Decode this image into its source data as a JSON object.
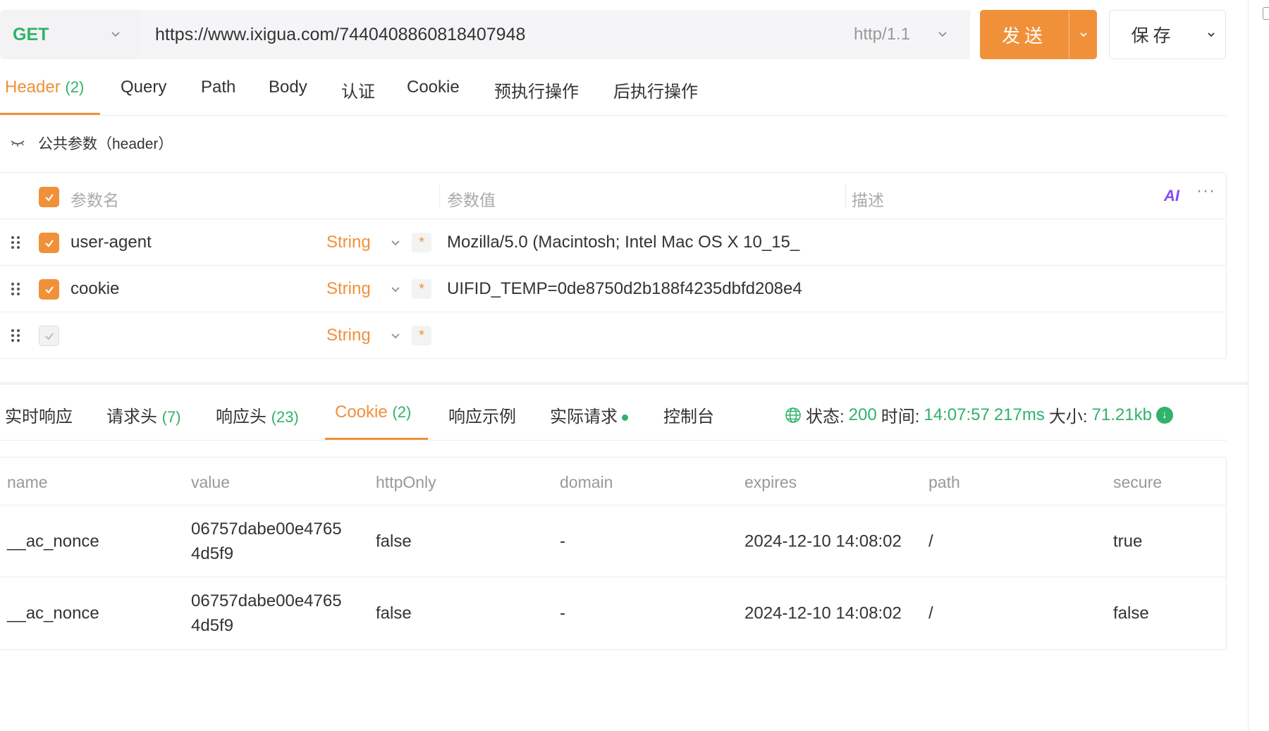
{
  "request": {
    "method": "GET",
    "url": "https://www.ixigua.com/7440408860818407948",
    "protocol": "http/1.1",
    "send_label": "发送",
    "save_label": "保存"
  },
  "request_tabs": [
    {
      "label": "Header",
      "count": "(2)",
      "active": true
    },
    {
      "label": "Query",
      "count": ""
    },
    {
      "label": "Path",
      "count": ""
    },
    {
      "label": "Body",
      "count": ""
    },
    {
      "label": "认证",
      "count": ""
    },
    {
      "label": "Cookie",
      "count": ""
    },
    {
      "label": "预执行操作",
      "count": ""
    },
    {
      "label": "后执行操作",
      "count": ""
    }
  ],
  "public_params": {
    "label": "公共参数（header）",
    "icon": "eye-closed-icon"
  },
  "header_table": {
    "columns": {
      "name": "参数名",
      "value": "参数值",
      "description": "描述"
    },
    "ai_label": "AI",
    "more_label": "···",
    "rows": [
      {
        "name": "user-agent",
        "type": "String",
        "required": "*",
        "value": "Mozilla/5.0 (Macintosh; Intel Mac OS X 10_15_",
        "checked": true
      },
      {
        "name": "cookie",
        "type": "String",
        "required": "*",
        "value": "UIFID_TEMP=0de8750d2b188f4235dbfd208e4",
        "checked": true
      },
      {
        "name": "",
        "type": "String",
        "required": "*",
        "value": "",
        "checked": false
      }
    ]
  },
  "response_tabs": [
    {
      "label": "实时响应",
      "count": ""
    },
    {
      "label": "请求头",
      "count": "(7)"
    },
    {
      "label": "响应头",
      "count": "(23)"
    },
    {
      "label": "Cookie",
      "count": "(2)",
      "active": true
    },
    {
      "label": "响应示例",
      "count": ""
    },
    {
      "label": "实际请求",
      "count": "",
      "dot": true
    },
    {
      "label": "控制台",
      "count": ""
    }
  ],
  "status": {
    "status_label": "状态:",
    "status_value": "200",
    "time_label": "时间:",
    "time_value": "14:07:57",
    "duration": "217ms",
    "size_label": "大小:",
    "size_value": "71.21kb"
  },
  "cookie_table": {
    "columns": [
      "name",
      "value",
      "httpOnly",
      "domain",
      "expires",
      "path",
      "secure"
    ],
    "rows": [
      [
        "__ac_nonce",
        "06757dabe00e47654d5f9",
        "false",
        "-",
        "2024-12-10 14:08:02",
        "/",
        "true"
      ],
      [
        "__ac_nonce",
        "06757dabe00e47654d5f9",
        "false",
        "-",
        "2024-12-10 14:08:02",
        "/",
        "false"
      ]
    ]
  },
  "colors": {
    "accent": "#f0913a",
    "success": "#30b26a",
    "ai": "#8a4af3"
  }
}
